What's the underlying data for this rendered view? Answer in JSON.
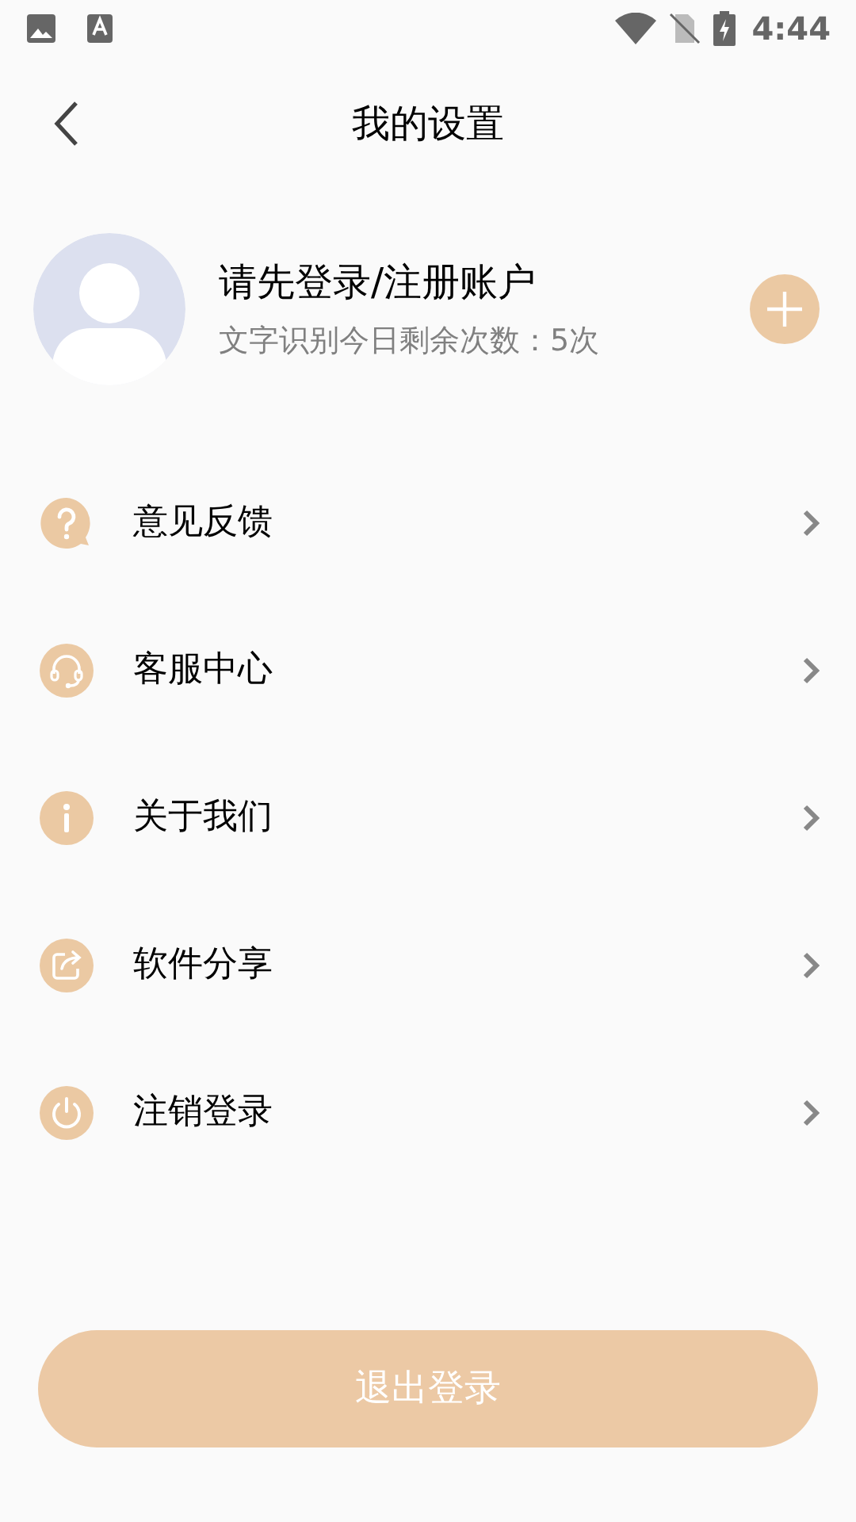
{
  "status_bar": {
    "time": "4:44"
  },
  "header": {
    "title": "我的设置"
  },
  "profile": {
    "name": "请先登录/注册账户",
    "quota": "文字识别今日剩余次数：5次"
  },
  "menu": [
    {
      "kind": "feedback",
      "label": "意见反馈"
    },
    {
      "kind": "service",
      "label": "客服中心"
    },
    {
      "kind": "about",
      "label": "关于我们"
    },
    {
      "kind": "share",
      "label": "软件分享"
    },
    {
      "kind": "logout",
      "label": "注销登录"
    }
  ],
  "logout_button": {
    "label": "退出登录"
  }
}
